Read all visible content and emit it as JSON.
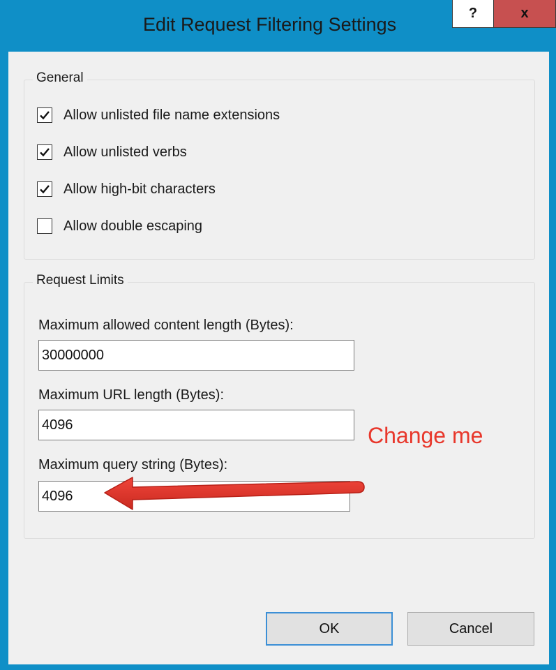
{
  "window": {
    "title": "Edit Request Filtering Settings",
    "help_label": "?",
    "close_label": "x"
  },
  "general": {
    "label": "General",
    "options": [
      {
        "label": "Allow unlisted file name extensions",
        "checked": true
      },
      {
        "label": "Allow unlisted verbs",
        "checked": true
      },
      {
        "label": "Allow high-bit characters",
        "checked": true
      },
      {
        "label": "Allow double escaping",
        "checked": false
      }
    ]
  },
  "limits": {
    "label": "Request Limits",
    "content_length_label": "Maximum allowed content length (Bytes):",
    "content_length_value": "30000000",
    "url_length_label": "Maximum URL length (Bytes):",
    "url_length_value": "4096",
    "query_string_label": "Maximum query string (Bytes):",
    "query_string_value": "4096"
  },
  "annotation": {
    "text": "Change me",
    "color": "#e8372b"
  },
  "buttons": {
    "ok": "OK",
    "cancel": "Cancel"
  },
  "icons": {
    "checkmark": "checkmark-icon",
    "arrow": "red-arrow-icon"
  },
  "colors": {
    "frame": "#0f8fc7",
    "close_button": "#c75050",
    "dialog_bg": "#f0f0f0"
  }
}
